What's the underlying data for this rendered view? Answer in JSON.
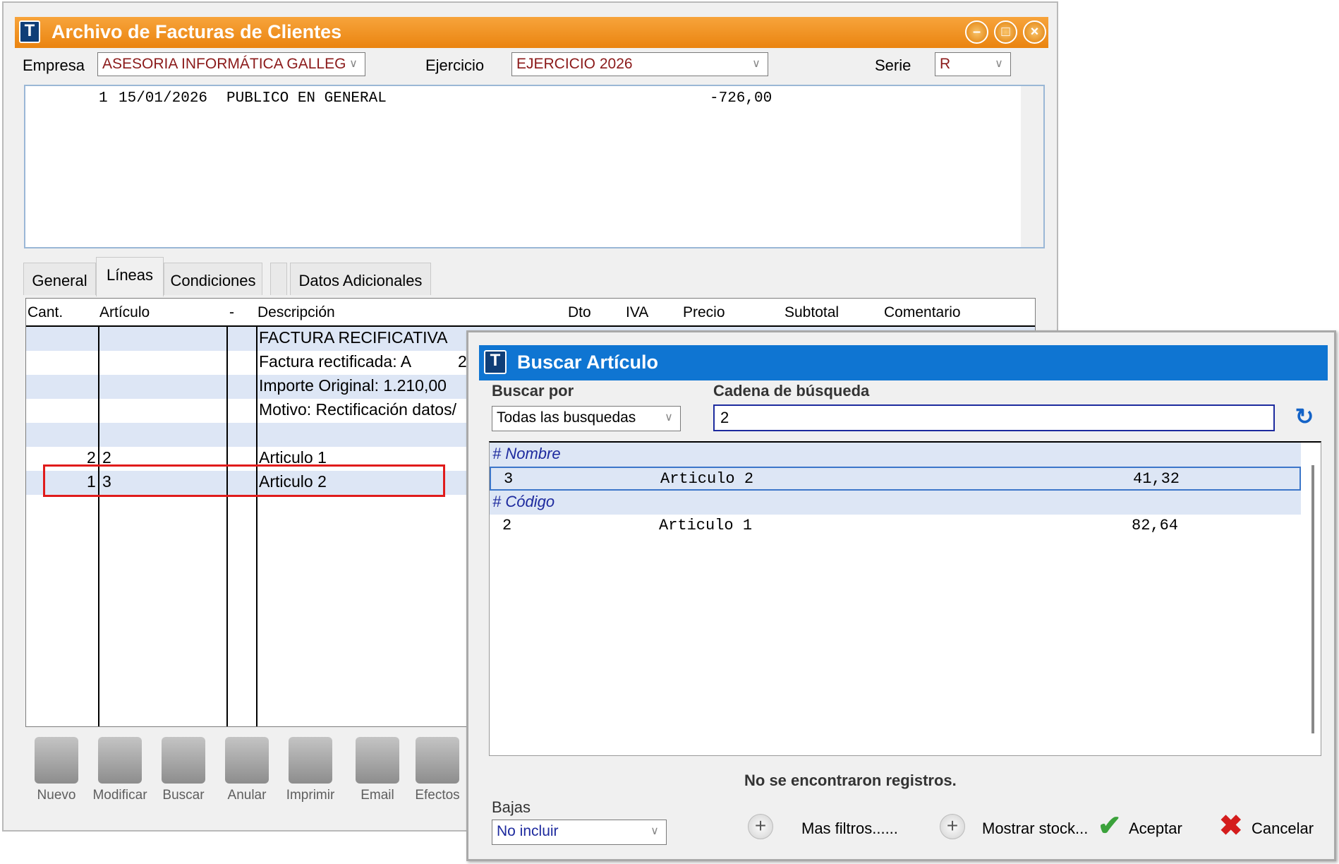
{
  "main": {
    "title": "Archivo de Facturas de Clientes",
    "logo": "T",
    "empresa_label": "Empresa",
    "empresa_value": "ASESORIA INFORMÁTICA GALLEG",
    "ejercicio_label": "Ejercicio",
    "ejercicio_value": "EJERCICIO 2026",
    "serie_label": "Serie",
    "serie_value": "R",
    "invoice_row": {
      "num": "1",
      "date": "15/01/2026",
      "client": "PUBLICO EN GENERAL",
      "amount": "-726,00"
    },
    "tabs": [
      "General",
      "Líneas",
      "Condiciones",
      "Datos Adicionales"
    ],
    "columns": [
      "Cant.",
      "Artículo",
      "-",
      "Descripción",
      "Dto",
      "IVA",
      "Precio",
      "Subtotal",
      "Comentario"
    ],
    "rows": [
      {
        "cant": "",
        "articulo": "",
        "desc": "FACTURA RECIFICATIVA",
        "extra": ""
      },
      {
        "cant": "",
        "articulo": "",
        "desc": "Factura rectificada: A",
        "extra": "2"
      },
      {
        "cant": "",
        "articulo": "",
        "desc": "Importe Original: 1.210,00",
        "extra": ""
      },
      {
        "cant": "",
        "articulo": "",
        "desc": "Motivo: Rectificación datos/",
        "extra": ""
      },
      {
        "cant": "",
        "articulo": "",
        "desc": "",
        "extra": ""
      },
      {
        "cant": "2",
        "articulo": "2",
        "desc": "Articulo 1",
        "extra": ""
      },
      {
        "cant": "1",
        "articulo": "3",
        "desc": "Articulo 2",
        "extra": ""
      }
    ],
    "toolbar": [
      "Nuevo",
      "Modificar",
      "Buscar",
      "Anular",
      "Imprimir",
      "Email",
      "Efectos"
    ]
  },
  "dialog": {
    "title": "Buscar Artículo",
    "logo": "T",
    "buscar_por_label": "Buscar por",
    "buscar_por_value": "Todas las busquedas",
    "cadena_label": "Cadena de búsqueda",
    "cadena_value": "2",
    "groups": [
      {
        "label": "# Nombre",
        "items": [
          {
            "code": "3",
            "name": "Articulo 2",
            "price": "41,32",
            "selected": true
          }
        ]
      },
      {
        "label": "# Código",
        "items": [
          {
            "code": "2",
            "name": "Articulo 1",
            "price": "82,64",
            "selected": false
          }
        ]
      }
    ],
    "status": "No se encontraron registros.",
    "bajas_label": "Bajas",
    "bajas_value": "No incluir",
    "mas_filtros": "Mas filtros......",
    "mostrar_stock": "Mostrar stock...",
    "aceptar": "Aceptar",
    "cancelar": "Cancelar"
  }
}
